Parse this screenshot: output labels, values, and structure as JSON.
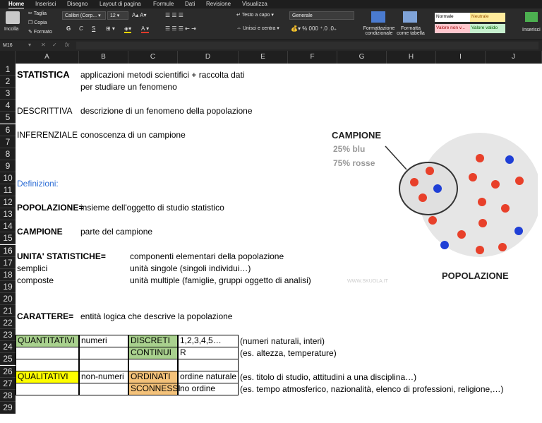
{
  "ribbon": {
    "tabs": [
      "Home",
      "Inserisci",
      "Disegno",
      "Layout di pagina",
      "Formule",
      "Dati",
      "Revisione",
      "Visualizza"
    ],
    "paste_label": "Incolla",
    "cut_label": "Taglia",
    "copy_label": "Copia",
    "format_painter_label": "Formato",
    "font_name": "Calibri (Corp...",
    "font_size": "12",
    "bold": "G",
    "italic": "C",
    "underline": "S",
    "wrap_text_label": "Testo a capo",
    "merge_center_label": "Unisci e centra",
    "number_format": "Generale",
    "conditional_format_label": "Formattazione condizionale",
    "format_table_label": "Formatta come tabella",
    "styles": {
      "normale": "Normale",
      "neutrale": "Neutrale",
      "valore_non": "Valore non v...",
      "valore_valido": "Valore valido"
    },
    "insert_label": "Inserisci"
  },
  "formula_bar": {
    "name_box": "M16",
    "fx": "fx",
    "formula": ""
  },
  "columns": [
    "A",
    "B",
    "C",
    "D",
    "E",
    "F",
    "G",
    "H",
    "I",
    "J"
  ],
  "rows": [
    "1",
    "2",
    "3",
    "4",
    "5",
    "6",
    "7",
    "8",
    "9",
    "10",
    "11",
    "12",
    "13",
    "14",
    "15",
    "16",
    "17",
    "18",
    "19",
    "20",
    "21",
    "22",
    "23",
    "24",
    "25",
    "26",
    "27",
    "28",
    "29"
  ],
  "cells": {
    "r1a": "STATISTICA",
    "r1b": "applicazioni metodi scientifici + raccolta dati",
    "r2b": "per studiare un fenomeno",
    "r4a": "DESCRITTIVA",
    "r4b": "descrizione di un fenomeno della popolazione",
    "r6a": "INFERENZIALE",
    "r6b": "conoscenza di un campione",
    "r10a": "Definizioni:",
    "r12a": "POPOLAZIONE=",
    "r12b": "insieme dell'oggetto di studio statistico",
    "r14a": "CAMPIONE",
    "r14b": "parte del campione",
    "r16a": "UNITA' STATISTICHE=",
    "r16c": "componenti elementari della popolazione",
    "r17a": "semplici",
    "r17c": "unità singole (singoli individui…)",
    "r18a": "composte",
    "r18c": "unità multiple (famiglie, gruppi oggetto di analisi)",
    "r21a": "CARATTERE=",
    "r21b": "entità logica che descrive la popolazione",
    "r23a": "QUANTITATIVI",
    "r23b": "numeri",
    "r23c": "DISCRETI",
    "r23d": "1,2,3,4,5…",
    "r23e": "(numeri naturali, interi)",
    "r24c": "CONTINUI",
    "r24d": "R",
    "r24e": "(es. altezza, temperature)",
    "r26a": "QUALITATIVI",
    "r26b": "non-numeri",
    "r26c": "ORDINATI",
    "r26d": "ordine naturale",
    "r26e": "(es. titolo di studio, attitudini a una disciplina…)",
    "r27c": "SCONNESSI",
    "r27d": "no ordine",
    "r27e": "(es. tempo atmosferico, nazionalità, elenco di professioni, religione,…)"
  },
  "image": {
    "campione_title": "CAMPIONE",
    "pct_blu": "25% blu",
    "pct_rosse": "75% rosse",
    "popolazione_title": "POPOLAZIONE",
    "watermark": "WWW.SKUOLA.IT",
    "colors": {
      "red": "#e8402a",
      "blue": "#1f3fd6",
      "circle": "#e6e6e6"
    }
  }
}
